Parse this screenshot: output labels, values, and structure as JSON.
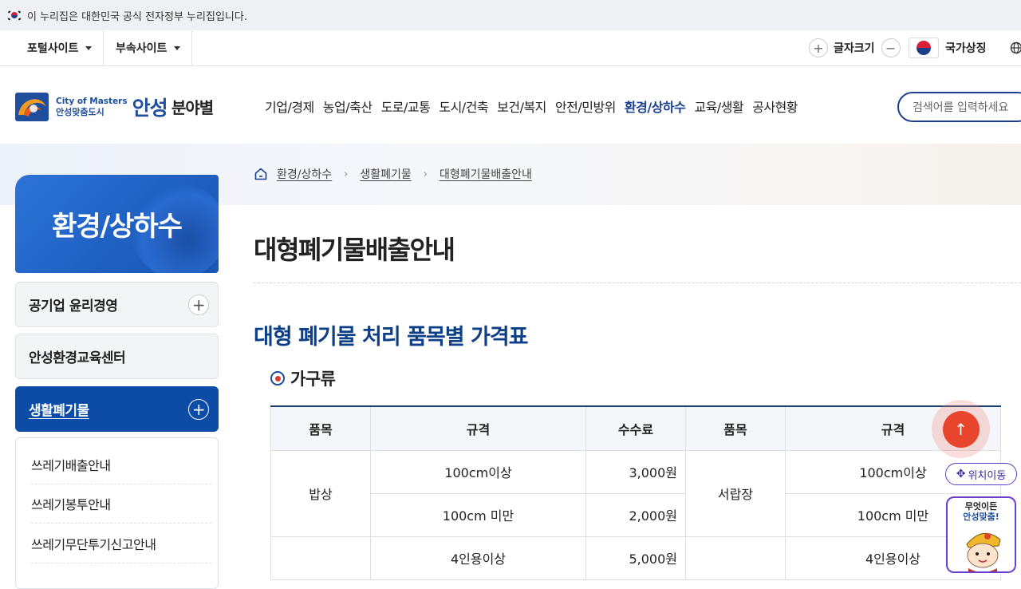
{
  "gov_banner": {
    "text": "이 누리집은 대한민국 공식 전자정부 누리집입니다."
  },
  "utility": {
    "portal_sites": "포털사이트",
    "affiliated_sites": "부속사이트",
    "font_size_label": "글자크기",
    "font_plus": "+",
    "font_minus": "−",
    "national_symbol": "국가상징"
  },
  "header": {
    "logo_en": "City of Masters",
    "logo_slogan": "안성맞춤도시",
    "logo_city": "안성",
    "category": "분야별",
    "nav": [
      "기업/경제",
      "농업/축산",
      "도로/교통",
      "도시/건축",
      "보건/복지",
      "안전/민방위",
      "환경/상하수",
      "교육/생활",
      "공사현황"
    ],
    "active_nav": "환경/상하수",
    "search_placeholder": "검색어를 입력하세요"
  },
  "breadcrumb": [
    "환경/상하수",
    "생활폐기물",
    "대형폐기물배출안내"
  ],
  "sidebar": {
    "title": "환경/상하수",
    "items": [
      {
        "label": "공기업 윤리경영",
        "expandable": true,
        "active": false
      },
      {
        "label": "안성환경교육센터",
        "expandable": false,
        "active": false
      },
      {
        "label": "생활폐기물",
        "expandable": true,
        "active": true
      }
    ],
    "sub_items": [
      "쓰레기배출안내",
      "쓰레기봉투안내",
      "쓰레기무단투기신고안내"
    ]
  },
  "content": {
    "page_title": "대형폐기물배출안내",
    "section_title": "대형 폐기물 처리 품목별 가격표",
    "subsection_title": "가구류",
    "table": {
      "headers": [
        "품목",
        "규격",
        "수수료",
        "품목",
        "규격"
      ],
      "rows": [
        {
          "item": "밥상",
          "spec": "100cm이상",
          "fee": "3,000원",
          "item2": "서랍장",
          "spec2": "100cm이상"
        },
        {
          "item": "",
          "spec": "100cm 미만",
          "fee": "2,000원",
          "item2": "",
          "spec2": "100cm 미만"
        },
        {
          "item": "",
          "spec": "4인용이상",
          "fee": "5,000원",
          "item2": "",
          "spec2": "4인용이상"
        }
      ]
    }
  },
  "floating": {
    "top_button": "↑",
    "move_label": "위치이동",
    "mascot_line1": "무엇이든",
    "mascot_line2": "안성맞춤!"
  }
}
